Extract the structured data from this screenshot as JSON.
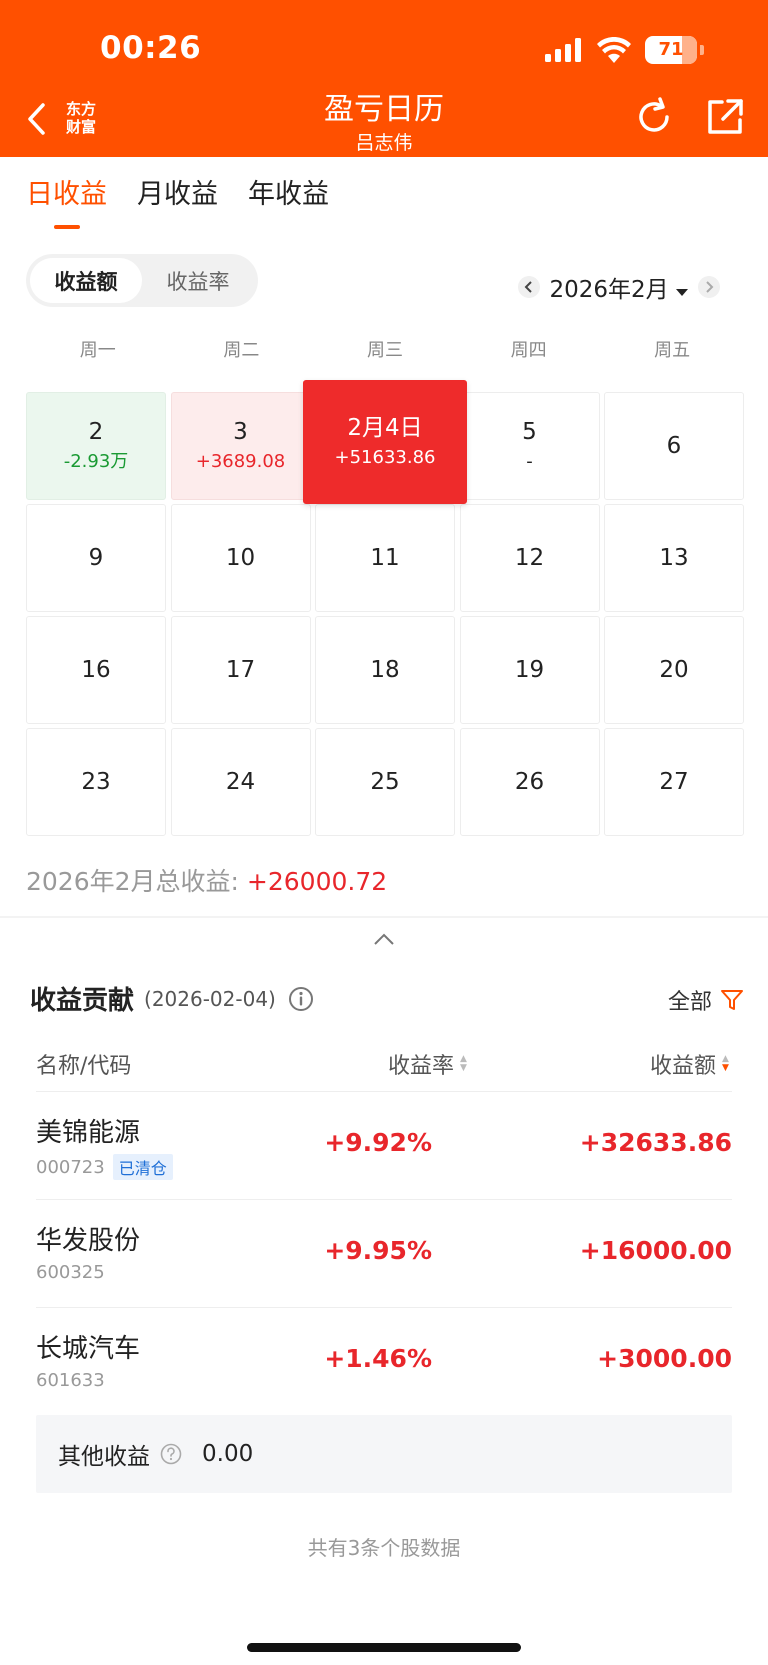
{
  "status_bar": {
    "time": "00:26",
    "battery": "71",
    "battery_level": 0.71
  },
  "header": {
    "logo_line1": "东方",
    "logo_line2": "财富",
    "title": "盈亏日历",
    "subtitle": "吕志伟"
  },
  "tabs": [
    {
      "label": "日收益",
      "active": true
    },
    {
      "label": "月收益",
      "active": false
    },
    {
      "label": "年收益",
      "active": false
    }
  ],
  "toggle": {
    "amount_label": "收益额",
    "rate_label": "收益率",
    "selected": "amount"
  },
  "month_nav": {
    "label": "2026年2月"
  },
  "weekdays": [
    "周一",
    "周二",
    "周三",
    "周四",
    "周五"
  ],
  "calendar": [
    {
      "day": "2",
      "value": "-2.93万",
      "state": "loss"
    },
    {
      "day": "3",
      "value": "+3689.08",
      "state": "gain"
    },
    {
      "day": "2月4日",
      "value": "+51633.86",
      "state": "selected"
    },
    {
      "day": "5",
      "value": "-",
      "state": "none"
    },
    {
      "day": "6",
      "value": "",
      "state": "empty"
    },
    {
      "day": "9",
      "value": "",
      "state": "empty"
    },
    {
      "day": "10",
      "value": "",
      "state": "empty"
    },
    {
      "day": "11",
      "value": "",
      "state": "empty"
    },
    {
      "day": "12",
      "value": "",
      "state": "empty"
    },
    {
      "day": "13",
      "value": "",
      "state": "empty"
    },
    {
      "day": "16",
      "value": "",
      "state": "empty"
    },
    {
      "day": "17",
      "value": "",
      "state": "empty"
    },
    {
      "day": "18",
      "value": "",
      "state": "empty"
    },
    {
      "day": "19",
      "value": "",
      "state": "empty"
    },
    {
      "day": "20",
      "value": "",
      "state": "empty"
    },
    {
      "day": "23",
      "value": "",
      "state": "empty"
    },
    {
      "day": "24",
      "value": "",
      "state": "empty"
    },
    {
      "day": "25",
      "value": "",
      "state": "empty"
    },
    {
      "day": "26",
      "value": "",
      "state": "empty"
    },
    {
      "day": "27",
      "value": "",
      "state": "empty"
    }
  ],
  "monthly_total": {
    "label": "2026年2月总收益:",
    "value": "+26000.72"
  },
  "contribution": {
    "title": "收益贡献",
    "date": "(2026-02-04)",
    "filter_label": "全部",
    "columns": {
      "name": "名称/代码",
      "rate": "收益率",
      "amount": "收益额"
    },
    "rows": [
      {
        "name": "美锦能源",
        "code": "000723",
        "tag": "已清仓",
        "rate": "+9.92%",
        "amount": "+32633.86"
      },
      {
        "name": "华发股份",
        "code": "600325",
        "tag": "",
        "rate": "+9.95%",
        "amount": "+16000.00"
      },
      {
        "name": "长城汽车",
        "code": "601633",
        "tag": "",
        "rate": "+1.46%",
        "amount": "+3000.00"
      }
    ],
    "other_label": "其他收益",
    "other_value": "0.00",
    "footer": "共有3条个股数据"
  },
  "colors": {
    "brand": "#ff5000",
    "gain": "#e8262b",
    "loss": "#1a9a33"
  },
  "icons": [
    "back-arrow-icon",
    "refresh-icon",
    "share-icon",
    "info-icon",
    "filter-icon",
    "question-icon",
    "chevron-up-icon"
  ]
}
